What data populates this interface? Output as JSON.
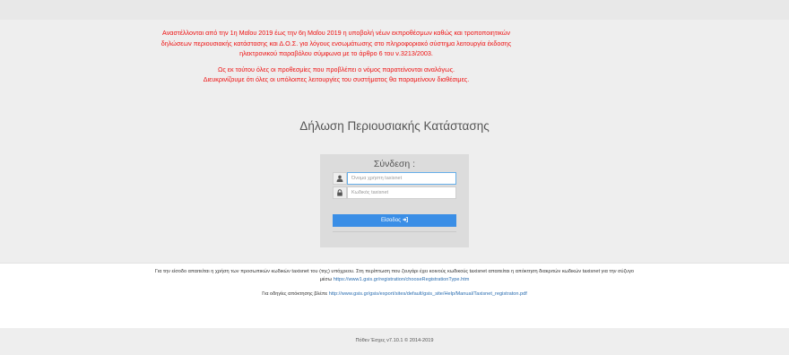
{
  "notice": {
    "line1": "Αναστέλλονται από την 1η Μαΐου 2019 έως την 6η Μαΐου 2019 η υποβολή νέων εκπροθέσμων καθώς και τροποποιητικών",
    "line2": "δηλώσεων περιουσιακής κατάστασης και Δ.Ο.Σ. για λόγους ενσωμάτωσης στο πληροφοριακό σύστημα λειτουργία έκδοσης",
    "line3": "ηλεκτρονικού παραβόλου σύμφωνα με το άρθρο 6 του ν.3213/2003.",
    "line4": "Ως εκ τούτου όλες οι προθεσμίες που προβλέπει ο νόμος παρατείνονται αναλόγως.",
    "line5": "Διευκρινίζουμε ότι όλες οι υπόλοιπες λειτουργίες του συστήματος θα παραμείνουν διαθέσιμες."
  },
  "page_title": "Δήλωση Περιουσιακής Κατάστασης",
  "login": {
    "heading": "Σύνδεση :",
    "username_placeholder": "Όνομα χρήστη taxisnet",
    "password_placeholder": "Κωδικός taxisnet",
    "submit_label": "Είσοδος",
    "submit_icon": "sign-in-icon",
    "user_icon": "user-icon",
    "lock_icon": "lock-icon"
  },
  "info": {
    "line1": "Για την είσοδο απαιτείται η χρήση των προσωπικών κωδικών taxisnet του (της) υπόχρεου. Στη περίπτωση που ζευγάρι έχει κοινούς κωδικούς taxisnet απαιτείται η απόκτηση διακριτών κωδικών taxisnet για την σύζυγο",
    "line2_prefix": "μέσω",
    "line2_link": "https://www1.gsis.gr/registration/chooseRegistrationType.htm",
    "line3_prefix": "Για οδηγίες απόκτησης βλέπε",
    "line3_link": "http://www.gsis.gr/gsis/export/sites/default/gsis_site/Help/Manual/Taxisnet_registraton.pdf"
  },
  "version": "Πόθεν Έσχες v7.10.1 © 2014-2019",
  "colors": {
    "notice": "#ee1111",
    "button": "#3a8ee6",
    "link": "#2a6db0"
  }
}
